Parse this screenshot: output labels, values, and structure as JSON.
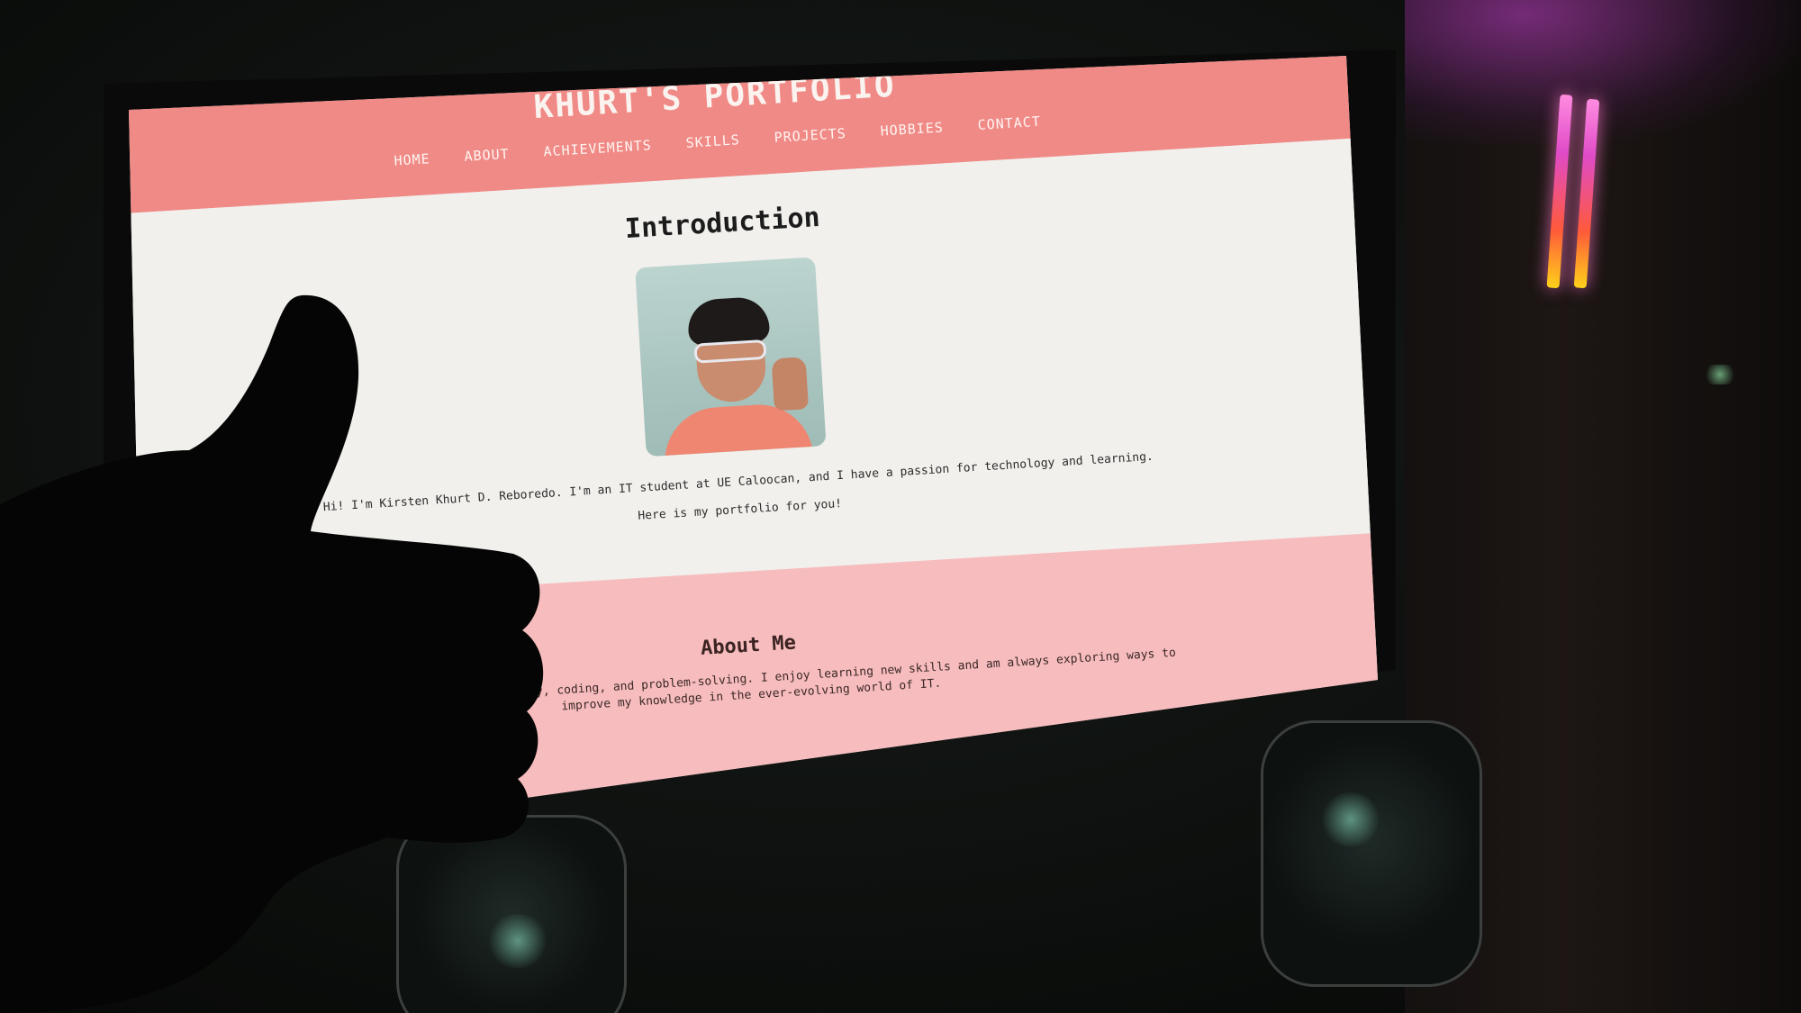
{
  "site": {
    "title": "KHURT'S PORTFOLIO"
  },
  "nav": {
    "items": [
      {
        "label": "HOME"
      },
      {
        "label": "ABOUT"
      },
      {
        "label": "ACHIEVEMENTS"
      },
      {
        "label": "SKILLS"
      },
      {
        "label": "PROJECTS"
      },
      {
        "label": "HOBBIES"
      },
      {
        "label": "CONTACT"
      }
    ]
  },
  "intro": {
    "heading": "Introduction",
    "text": "Hi! I'm Kirsten Khurt D. Reboredo. I'm an IT student at UE Caloocan, and I have a passion for technology and learning.",
    "subtext": "Here is my portfolio for you!"
  },
  "about": {
    "heading": "About Me",
    "text": "I have a passion for technology, coding, and problem-solving. I enjoy learning new skills and am always exploring ways to improve my knowledge in the ever-evolving world of IT."
  },
  "colors": {
    "header": "#f08a87",
    "about_section": "#f7bcbd",
    "page_background": "#f1f0ec"
  }
}
